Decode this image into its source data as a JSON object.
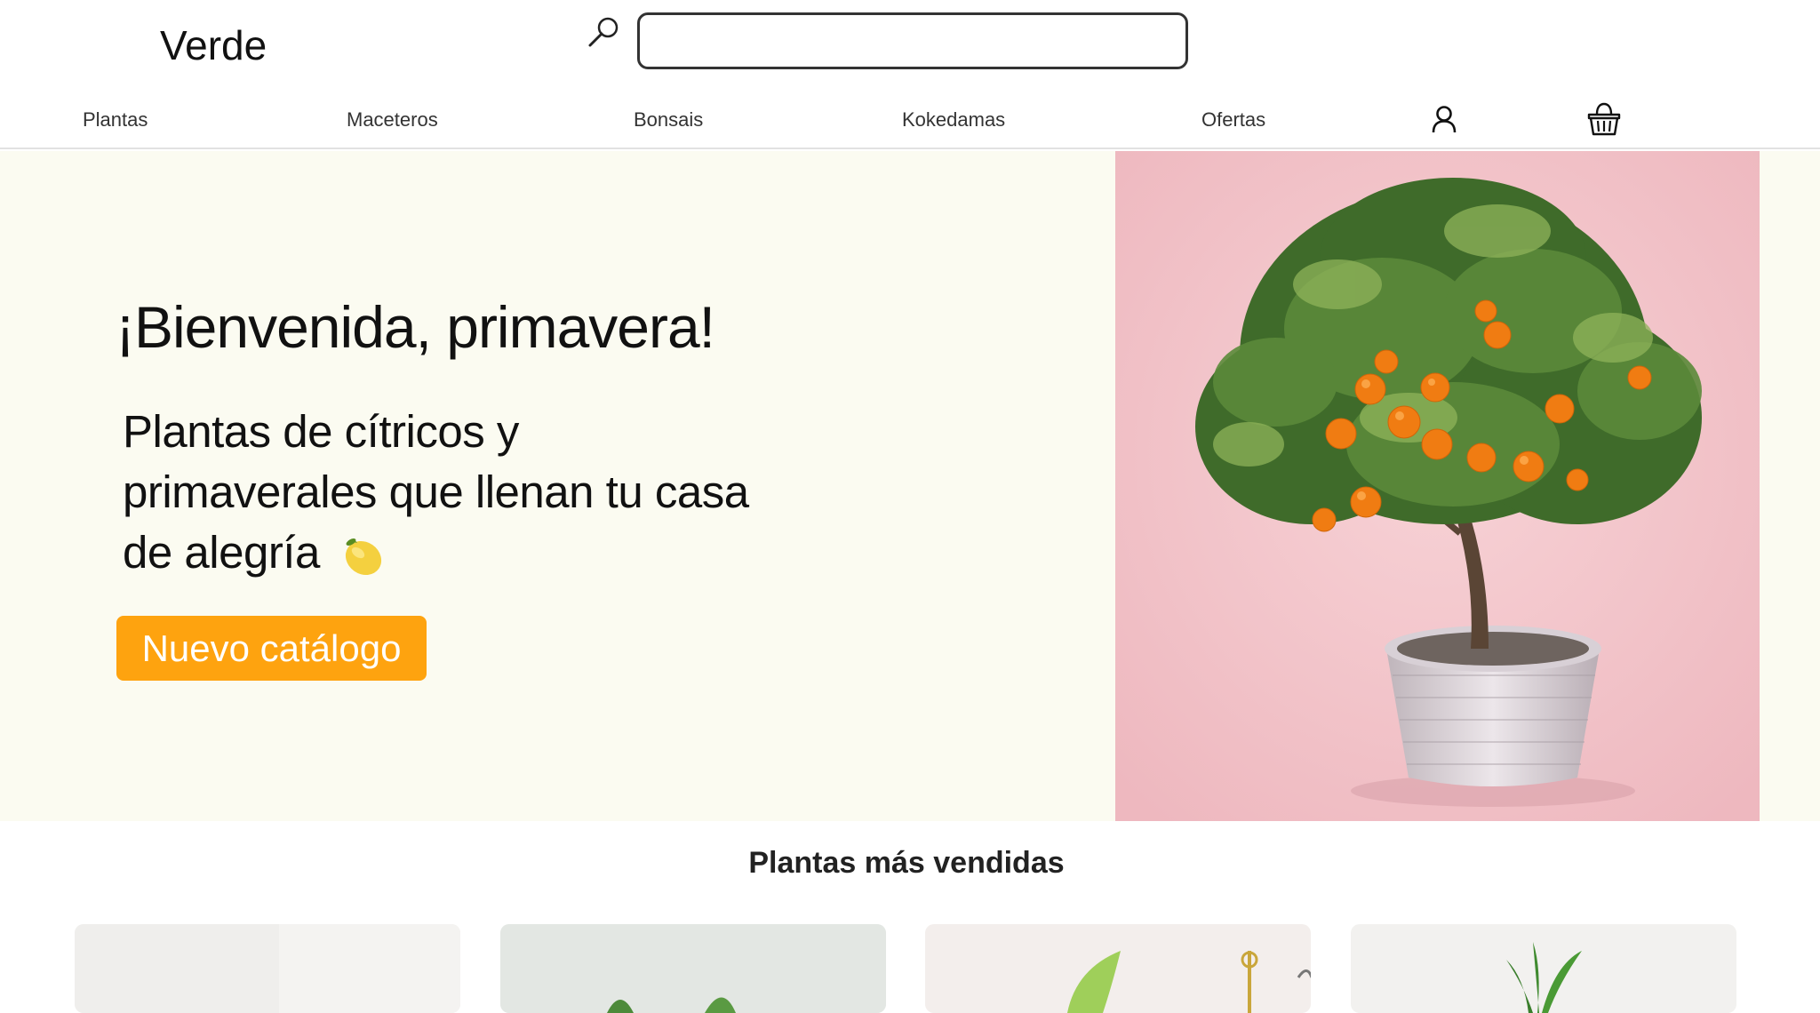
{
  "brand": {
    "logo": "Verde"
  },
  "search": {
    "placeholder": ""
  },
  "nav": {
    "items": [
      {
        "label": "Plantas"
      },
      {
        "label": "Maceteros"
      },
      {
        "label": "Bonsais"
      },
      {
        "label": "Kokedamas"
      },
      {
        "label": "Ofertas"
      }
    ]
  },
  "icons": {
    "search": "search-icon",
    "user": "user-icon",
    "cart": "basket-icon",
    "emoji": "lemon-icon"
  },
  "hero": {
    "title": "¡Bienvenida, primavera!",
    "subtitle": "Plantas de cítricos y primaverales que llenan tu casa de alegría",
    "cta_label": "Nuevo catálogo"
  },
  "bestsellers": {
    "title": "Plantas más vendidas"
  },
  "colors": {
    "accent": "#fea30f",
    "hero_bg": "#fbfbf1",
    "photo_bg": "#f3c4c9"
  }
}
